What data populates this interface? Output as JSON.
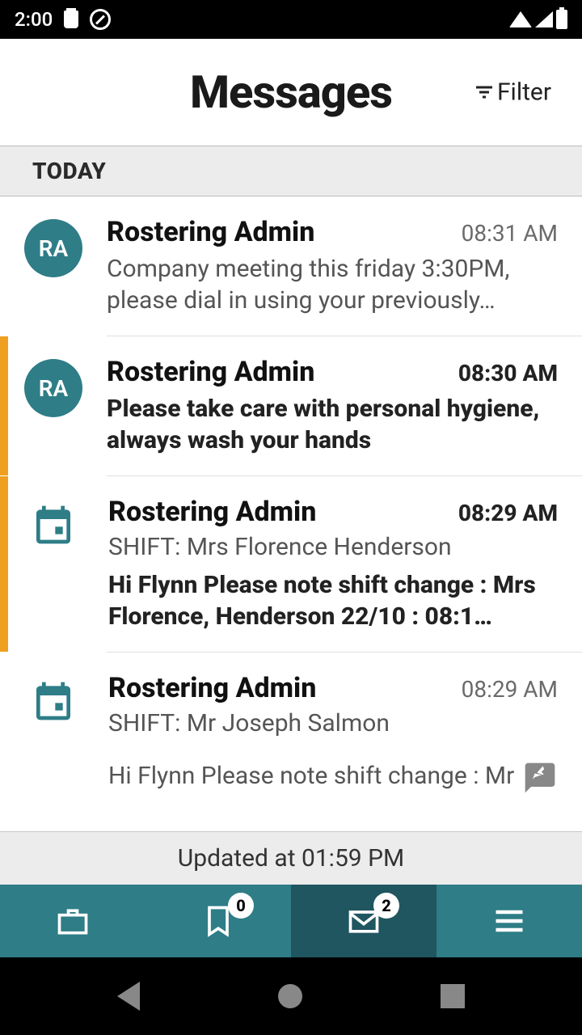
{
  "status": {
    "time": "2:00"
  },
  "header": {
    "title": "Messages",
    "filter_label": "Filter"
  },
  "section": {
    "today": "TODAY"
  },
  "messages": [
    {
      "avatar_type": "initials",
      "initials": "RA",
      "sender": "Rostering Admin",
      "time": "08:31 AM",
      "unread": false,
      "time_bold": false,
      "subject": "",
      "body": "Company meeting this friday 3:30PM, please dial in using your previously…",
      "body_bold": false
    },
    {
      "avatar_type": "initials",
      "initials": "RA",
      "sender": "Rostering Admin",
      "time": "08:30 AM",
      "unread": true,
      "time_bold": true,
      "subject": "",
      "body": "Please take care with personal hygiene, always wash your hands",
      "body_bold": true
    },
    {
      "avatar_type": "calendar",
      "initials": "",
      "sender": "Rostering Admin",
      "time": "08:29 AM",
      "unread": true,
      "time_bold": true,
      "subject": "SHIFT: Mrs Florence Henderson",
      "body": "Hi Flynn Please note shift change : Mrs Florence, Henderson 22/10 : 08:1…",
      "body_bold": true
    },
    {
      "avatar_type": "calendar",
      "initials": "",
      "sender": "Rostering Admin",
      "time": "08:29 AM",
      "unread": false,
      "time_bold": false,
      "subject": "SHIFT: Mr Joseph Salmon",
      "body": "Hi Flynn Please note shift change : Mr",
      "body_bold": false
    }
  ],
  "updated_label": "Updated at 01:59 PM",
  "bottom_nav": {
    "bookmarks_badge": "0",
    "messages_badge": "2"
  },
  "colors": {
    "teal": "#2e7d87",
    "teal_dark": "#1f5660",
    "unread_accent": "#f0a020"
  }
}
